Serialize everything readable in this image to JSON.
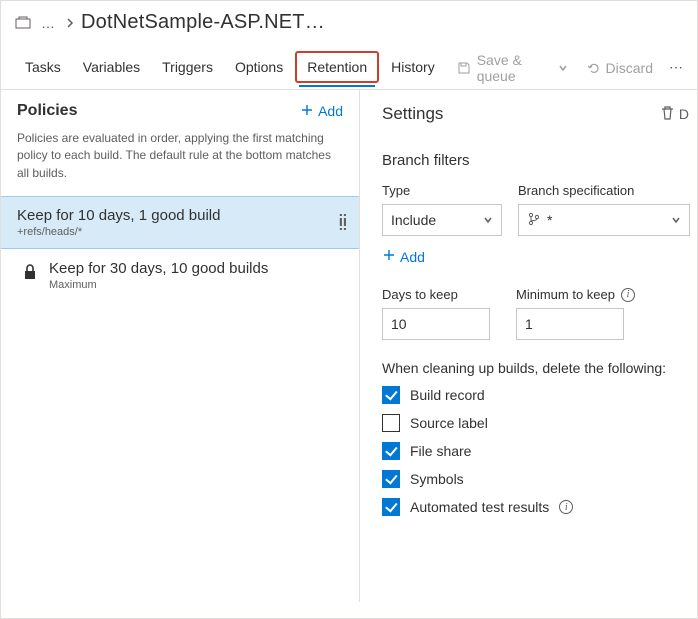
{
  "header": {
    "title": "DotNetSample-ASP.NET…"
  },
  "tabs": {
    "tasks": "Tasks",
    "variables": "Variables",
    "triggers": "Triggers",
    "options": "Options",
    "retention": "Retention",
    "history": "History"
  },
  "actions": {
    "save_queue": "Save & queue",
    "discard": "Discard"
  },
  "policies_panel": {
    "title": "Policies",
    "add": "Add",
    "description": "Policies are evaluated in order, applying the first matching policy to each build. The default rule at the bottom matches all builds."
  },
  "policies": [
    {
      "title": "Keep for 10 days, 1 good build",
      "sub": "+refs/heads/*"
    },
    {
      "title": "Keep for 30 days, 10 good builds",
      "sub": "Maximum"
    }
  ],
  "settings": {
    "title": "Settings",
    "delete_cut": "D",
    "branch_filters_heading": "Branch filters",
    "type_label": "Type",
    "type_value": "Include",
    "branch_spec_label": "Branch specification",
    "branch_spec_value": "*",
    "add": "Add",
    "days_label": "Days to keep",
    "days_value": "10",
    "min_label": "Minimum to keep",
    "min_value": "1",
    "cleanup_text": "When cleaning up builds, delete the following:",
    "checks": [
      {
        "label": "Build record",
        "checked": true
      },
      {
        "label": "Source label",
        "checked": false
      },
      {
        "label": "File share",
        "checked": true
      },
      {
        "label": "Symbols",
        "checked": true
      },
      {
        "label": "Automated test results",
        "checked": true,
        "info": true
      }
    ]
  }
}
